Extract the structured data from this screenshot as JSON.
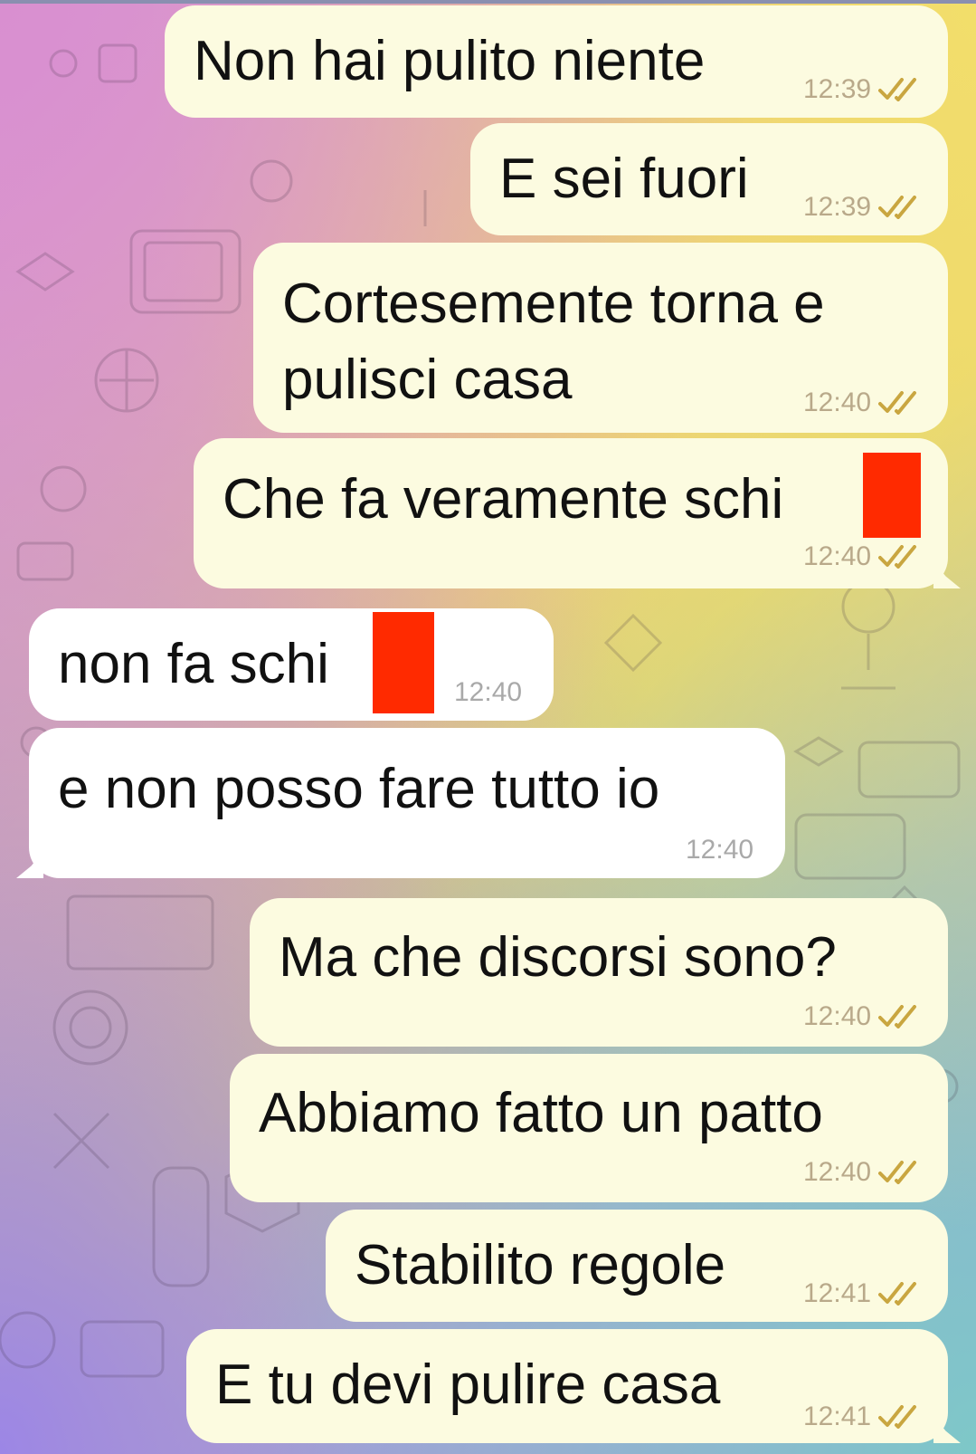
{
  "messages": [
    {
      "direction": "outgoing",
      "text": "Non hai pulito niente",
      "time": "12:39",
      "status": "read"
    },
    {
      "direction": "outgoing",
      "text": "E sei fuori",
      "time": "12:39",
      "status": "read"
    },
    {
      "direction": "outgoing",
      "text_line1": "Cortesemente torna e",
      "text_line2": "pulisci casa",
      "time": "12:40",
      "status": "read"
    },
    {
      "direction": "outgoing",
      "text": "Che fa veramente schi",
      "time": "12:40",
      "status": "read",
      "redacted": true
    },
    {
      "direction": "incoming",
      "text": "non fa schi",
      "time": "12:40",
      "redacted": true
    },
    {
      "direction": "incoming",
      "text": "e non posso fare tutto io",
      "time": "12:40"
    },
    {
      "direction": "outgoing",
      "text": "Ma che discorsi sono?",
      "time": "12:40",
      "status": "read"
    },
    {
      "direction": "outgoing",
      "text": "Abbiamo fatto un patto",
      "time": "12:40",
      "status": "read"
    },
    {
      "direction": "outgoing",
      "text": "Stabilito regole",
      "time": "12:41",
      "status": "read"
    },
    {
      "direction": "outgoing",
      "text": "E tu devi pulire casa",
      "time": "12:41",
      "status": "read"
    }
  ],
  "colors": {
    "outgoing_bubble": "#fcfbe0",
    "incoming_bubble": "#ffffff",
    "read_check": "#c9a640",
    "redaction": "#ff2a00"
  },
  "icons": {
    "read_status": "double-check-icon",
    "background": "doodle-pattern"
  }
}
